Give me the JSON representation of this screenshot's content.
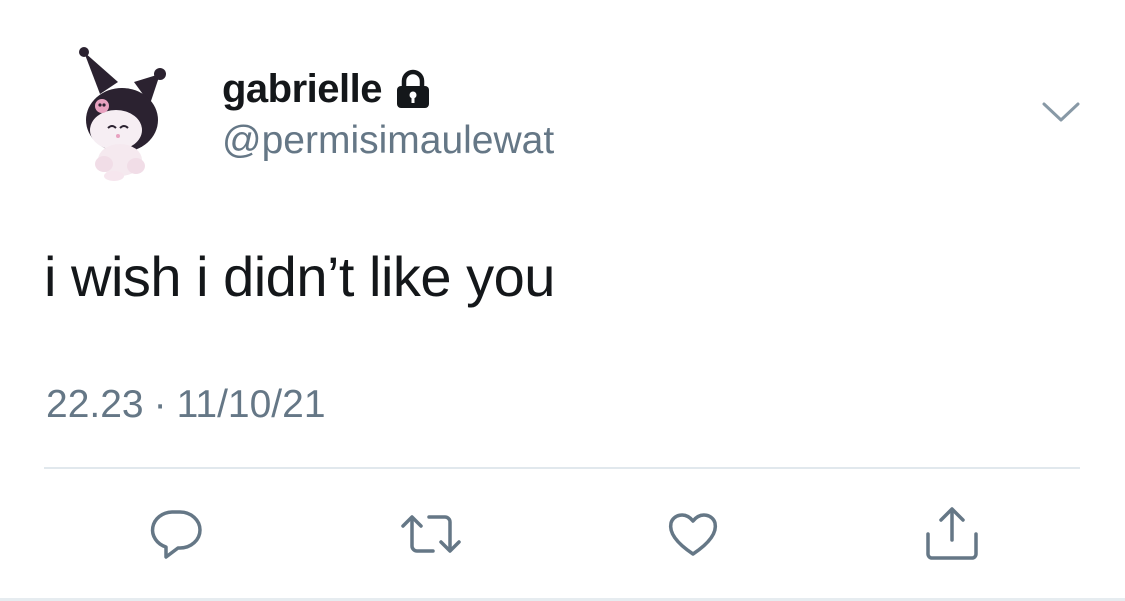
{
  "user": {
    "display_name": "gabrielle",
    "handle": "@permisimaulewat",
    "protected": true,
    "avatar_icon": "kuromi-avatar"
  },
  "tweet": {
    "text": "i wish i didn’t like you",
    "time": "22.23",
    "separator": "·",
    "date": "11/10/21"
  },
  "menu": {
    "icon": "chevron-down-icon"
  },
  "actions": [
    {
      "icon": "reply-icon"
    },
    {
      "icon": "retweet-icon"
    },
    {
      "icon": "like-icon"
    },
    {
      "icon": "share-icon"
    }
  ],
  "colors": {
    "primary_text": "#14171a",
    "secondary_text": "#657786",
    "icon": "#657786",
    "divider": "#e1e8ed"
  }
}
